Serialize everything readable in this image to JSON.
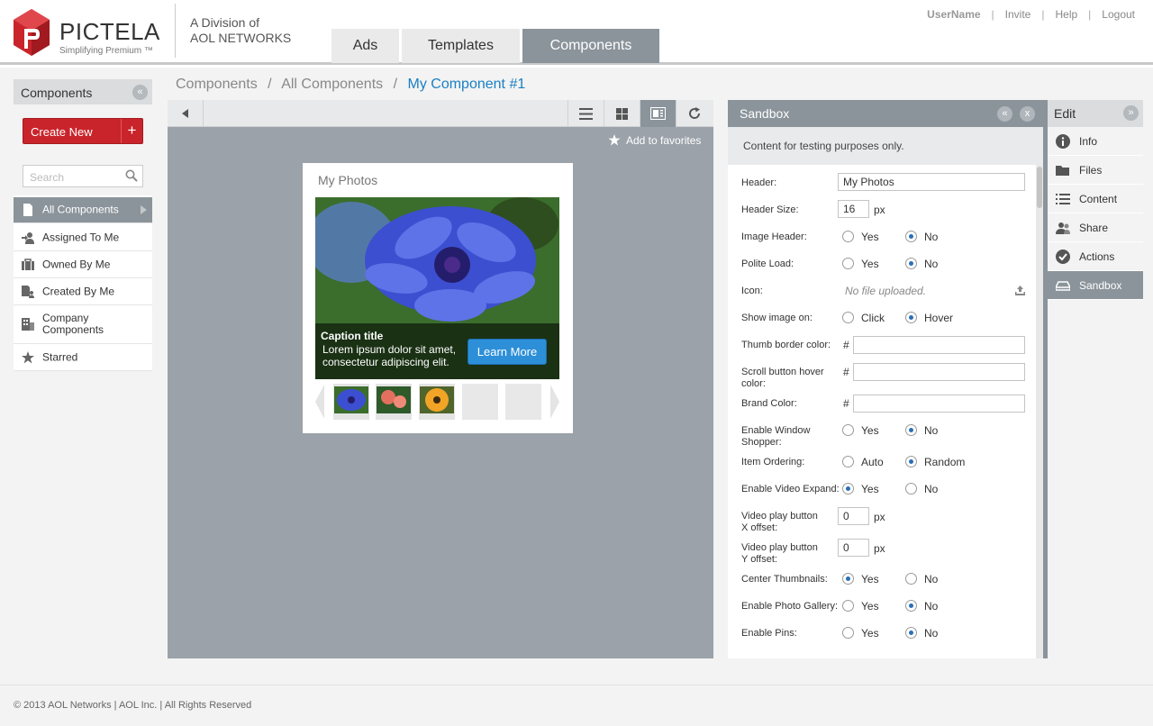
{
  "brand": {
    "name": "PICTELA",
    "tagline": "Simplifying Premium ™",
    "division_line1": "A Division of",
    "division_line2": "AOL NETWORKS",
    "accent": "#c9242b"
  },
  "top_links": {
    "user": "UserName",
    "invite": "Invite",
    "help": "Help",
    "logout": "Logout",
    "separator": "|"
  },
  "tabs": [
    {
      "label": "Ads"
    },
    {
      "label": "Templates"
    },
    {
      "label": "Components",
      "active": true
    }
  ],
  "left_panel": {
    "title": "Components",
    "collapse_icon": "«",
    "create_label": "Create New",
    "create_plus": "+",
    "search_placeholder": "Search",
    "items": [
      {
        "label": "All Components",
        "icon": "document-icon",
        "active": true
      },
      {
        "label": "Assigned To Me",
        "icon": "user-assign-icon"
      },
      {
        "label": "Owned By Me",
        "icon": "briefcase-icon"
      },
      {
        "label": "Created By Me",
        "icon": "doc-user-icon"
      },
      {
        "label": "Company Components",
        "icon": "building-icon"
      },
      {
        "label": "Starred",
        "icon": "star-icon"
      }
    ]
  },
  "breadcrumb": {
    "items": [
      "Components",
      "All Components"
    ],
    "current": "My Component #1",
    "separator": "/"
  },
  "preview": {
    "favorite_label": "Add to favorites",
    "widget_title": "My Photos",
    "caption_title": "Caption title",
    "caption_body": "Lorem ipsum dolor sit amet, consectetur adipiscing elit.",
    "learn_more": "Learn More"
  },
  "sandbox": {
    "title": "Sandbox",
    "collapse_icon": "«",
    "close_icon": "x",
    "note": "Content for testing purposes only.",
    "fields": {
      "header": {
        "label": "Header:",
        "value": "My Photos"
      },
      "header_size": {
        "label": "Header Size:",
        "value": "16",
        "unit": "px"
      },
      "image_header": {
        "label": "Image Header:",
        "options": [
          "Yes",
          "No"
        ],
        "selected": "No"
      },
      "polite_load": {
        "label": "Polite Load:",
        "options": [
          "Yes",
          "No"
        ],
        "selected": "No"
      },
      "icon": {
        "label": "Icon:",
        "value": "No file uploaded."
      },
      "show_image_on": {
        "label": "Show image on:",
        "options": [
          "Click",
          "Hover"
        ],
        "selected": "Hover"
      },
      "thumb_border": {
        "label": "Thumb border color:",
        "prefix": "#",
        "value": ""
      },
      "scroll_hover": {
        "label": "Scroll button hover color:",
        "prefix": "#",
        "value": ""
      },
      "brand_color": {
        "label": "Brand Color:",
        "prefix": "#",
        "value": ""
      },
      "window_shopper": {
        "label": "Enable Window Shopper:",
        "options": [
          "Yes",
          "No"
        ],
        "selected": "No"
      },
      "item_ordering": {
        "label": "Item Ordering:",
        "options": [
          "Auto",
          "Random"
        ],
        "selected": "Random"
      },
      "video_expand": {
        "label": "Enable Video Expand:",
        "options": [
          "Yes",
          "No"
        ],
        "selected": "Yes"
      },
      "video_x": {
        "label": "Video play button X offset:",
        "value": "0",
        "unit": "px"
      },
      "video_y": {
        "label": "Video play button Y offset:",
        "value": "0",
        "unit": "px"
      },
      "center_thumbs": {
        "label": "Center Thumbnails:",
        "options": [
          "Yes",
          "No"
        ],
        "selected": "Yes"
      },
      "photo_gallery": {
        "label": "Enable Photo Gallery:",
        "options": [
          "Yes",
          "No"
        ],
        "selected": "No"
      },
      "pins": {
        "label": "Enable Pins:",
        "options": [
          "Yes",
          "No"
        ],
        "selected": "No"
      }
    }
  },
  "edit_panel": {
    "title": "Edit",
    "expand_icon": "»",
    "items": [
      {
        "label": "Info",
        "icon": "info-icon"
      },
      {
        "label": "Files",
        "icon": "folder-icon"
      },
      {
        "label": "Content",
        "icon": "list-icon"
      },
      {
        "label": "Share",
        "icon": "share-users-icon"
      },
      {
        "label": "Actions",
        "icon": "check-circle-icon"
      },
      {
        "label": "Sandbox",
        "icon": "tray-icon",
        "active": true
      }
    ]
  },
  "footer": {
    "text": "© 2013 AOL Networks | AOL Inc. | All Rights Reserved"
  }
}
